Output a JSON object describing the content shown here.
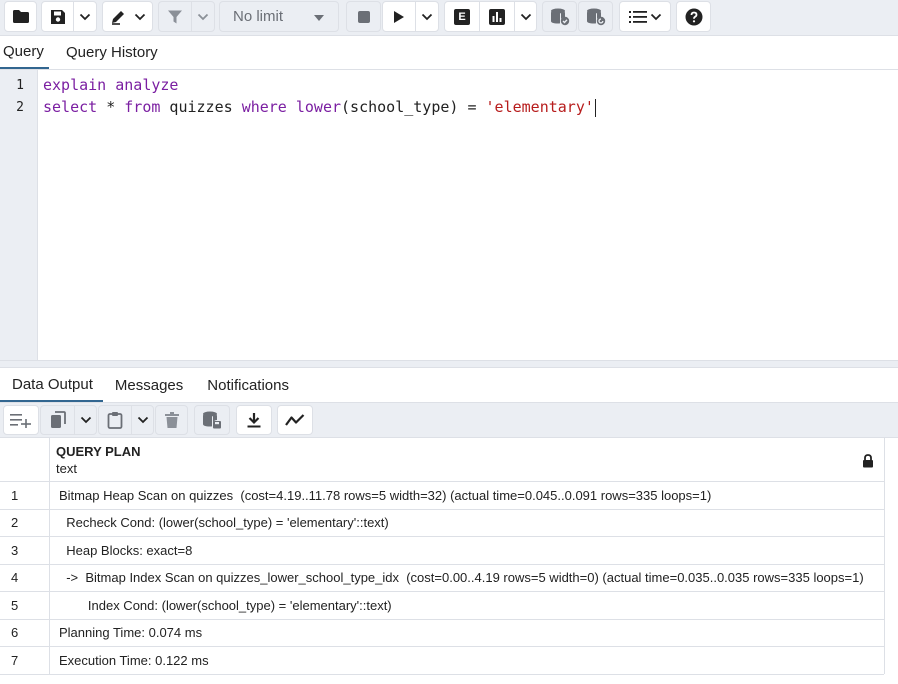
{
  "toolbar": {
    "limit_select": "No limit",
    "buttons": [
      "open-file",
      "save",
      "save-options",
      "edit",
      "filter",
      "filter-options",
      "stop",
      "execute",
      "execute-options",
      "explain",
      "explain-analyze",
      "explain-options",
      "commit",
      "rollback",
      "macros"
    ],
    "explain_letter": "E"
  },
  "tabs": {
    "query": "Query",
    "history": "Query History"
  },
  "editor": {
    "line_numbers": [
      "1",
      "2"
    ],
    "line1": {
      "kw1": "explain",
      "sp": " ",
      "kw2": "analyze"
    },
    "line2": {
      "kw_select": "select",
      "t1": " * ",
      "kw_from": "from",
      "t2": " quizzes ",
      "kw_where": "where",
      "t3": " ",
      "kw_lower": "lower",
      "t4": "(school_type) = ",
      "str": "'elementary'"
    }
  },
  "results": {
    "tabs": {
      "data_output": "Data Output",
      "messages": "Messages",
      "notifications": "Notifications"
    },
    "column": {
      "name": "QUERY PLAN",
      "type": "text"
    },
    "rows": [
      {
        "n": "1",
        "v": "Bitmap Heap Scan on quizzes  (cost=4.19..11.78 rows=5 width=32) (actual time=0.045..0.091 rows=335 loops=1)"
      },
      {
        "n": "2",
        "v": "  Recheck Cond: (lower(school_type) = 'elementary'::text)"
      },
      {
        "n": "3",
        "v": "  Heap Blocks: exact=8"
      },
      {
        "n": "4",
        "v": "  ->  Bitmap Index Scan on quizzes_lower_school_type_idx  (cost=0.00..4.19 rows=5 width=0) (actual time=0.035..0.035 rows=335 loops=1)"
      },
      {
        "n": "5",
        "v": "        Index Cond: (lower(school_type) = 'elementary'::text)"
      },
      {
        "n": "6",
        "v": "Planning Time: 0.074 ms"
      },
      {
        "n": "7",
        "v": "Execution Time: 0.122 ms"
      }
    ]
  },
  "colors": {
    "keyword": "#7b1fa2",
    "string": "#b71c1c",
    "accent": "#326690",
    "toolbar_bg": "#ebeef3"
  }
}
